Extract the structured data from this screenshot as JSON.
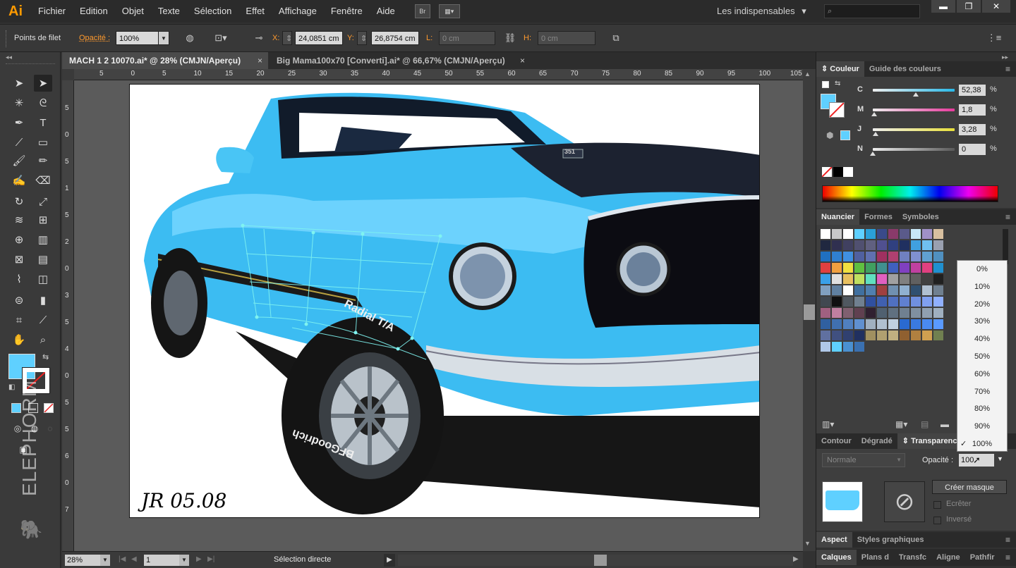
{
  "app": {
    "logo": "Ai"
  },
  "menu": [
    "Fichier",
    "Edition",
    "Objet",
    "Texte",
    "Sélection",
    "Effet",
    "Affichage",
    "Fenêtre",
    "Aide"
  ],
  "menubar_icons": {
    "bridge": "Br",
    "arrange": "arrange-documents-icon"
  },
  "workspace": {
    "label": "Les indispensables",
    "arrow": "▾"
  },
  "window_buttons": {
    "minimize": "▬",
    "maximize": "❐",
    "close": "✕"
  },
  "control": {
    "selection_label": "Points de filet",
    "opacity_label": "Opacité :",
    "opacity_value": "100%",
    "x_label": "X:",
    "x_value": "24,0851 cm",
    "y_label": "Y:",
    "y_value": "26,8754 cm",
    "w_label": "L:",
    "w_value": "0 cm",
    "h_label": "H:",
    "h_value": "0 cm"
  },
  "tabs": [
    {
      "label": "MACH 1 2 10070.ai* @ 28% (CMJN/Aperçu)",
      "close": "×"
    },
    {
      "label": "Big Mama100x70 [Converti].ai* @ 66,67% (CMJN/Aperçu)",
      "close": "×"
    }
  ],
  "ruler_h": [
    "5",
    "0",
    "5",
    "10",
    "15",
    "20",
    "25",
    "30",
    "35",
    "40",
    "45",
    "50",
    "55",
    "60",
    "65",
    "70",
    "75",
    "80",
    "85",
    "90",
    "95",
    "100",
    "105"
  ],
  "ruler_v": [
    "5",
    "0",
    "5",
    "1",
    "5",
    "2",
    "0",
    "3",
    "5",
    "4",
    "0",
    "5",
    "5",
    "6",
    "0",
    "7"
  ],
  "artwork": {
    "signature": "JR 05.08",
    "badge": "351",
    "tire_text": "Radial T/A",
    "tire_text2": "BFGoodrich"
  },
  "watermark": "ELEPHORM",
  "status": {
    "zoom": "28%",
    "page": "1",
    "tool_name": "Sélection directe",
    "nav_first": "|◀",
    "nav_prev": "◀",
    "nav_next": "▶",
    "nav_last": "▶|",
    "play": "▶"
  },
  "color_panel": {
    "tabs": [
      "Couleur",
      "Guide des couleurs"
    ],
    "fill_color": "#5fd0ff",
    "channels": [
      {
        "letter": "C",
        "value": "52,38",
        "unit": "%",
        "level": 0.5238,
        "color": "#29b9e8"
      },
      {
        "letter": "M",
        "value": "1,8",
        "unit": "%",
        "level": 0.018,
        "color": "#e83a9d"
      },
      {
        "letter": "J",
        "value": "3,28",
        "unit": "%",
        "level": 0.0328,
        "color": "#e8e03a"
      },
      {
        "letter": "N",
        "value": "0",
        "unit": "%",
        "level": 0,
        "color": "#5a5a5a"
      }
    ]
  },
  "swatches_panel": {
    "tabs": [
      "Nuancier",
      "Formes",
      "Symboles"
    ]
  },
  "transparency_panel": {
    "tabs": [
      "Contour",
      "Dégradé",
      "Transparence"
    ],
    "blend_mode": "Normale",
    "opacity_label": "Opacité :",
    "opacity_value": "100",
    "opacity_options": [
      "0%",
      "10%",
      "20%",
      "30%",
      "40%",
      "50%",
      "60%",
      "70%",
      "80%",
      "90%",
      "100%"
    ],
    "selected_option": "100%",
    "check_mark": "✓",
    "make_mask": "Créer masque",
    "clip": "Ecrêter",
    "invert": "Inversé"
  },
  "aspect_panel": {
    "tabs": [
      "Aspect",
      "Styles graphiques"
    ]
  },
  "layers_panel": {
    "tabs": [
      "Calques",
      "Plans d",
      "Transfc",
      "Aligne",
      "Pathfir"
    ]
  }
}
